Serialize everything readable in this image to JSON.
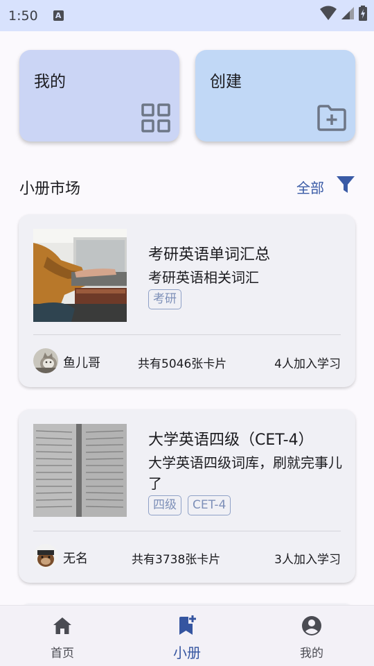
{
  "status_bar": {
    "time": "1:50",
    "notification_letter": "A"
  },
  "quick_actions": [
    {
      "label": "我的",
      "icon": "grid-icon"
    },
    {
      "label": "创建",
      "icon": "folder-plus-icon"
    }
  ],
  "market": {
    "title": "小册市场",
    "filter_label": "全部",
    "filter_icon": "filter-icon"
  },
  "books": [
    {
      "title": "考研英语单词汇总",
      "description": "考研英语相关词汇",
      "tags": [
        "考研"
      ],
      "author": "鱼儿哥",
      "card_count": "共有5046张卡片",
      "learners": "4人加入学习",
      "cover": "person-typing-on-laptop"
    },
    {
      "title": "大学英语四级（CET-4）",
      "description": "大学英语四级词库，刷就完事儿了",
      "tags": [
        "四级",
        "CET-4"
      ],
      "author": "无名",
      "card_count": "共有3738张卡片",
      "learners": "3人加入学习",
      "cover": "open-dictionary-pages"
    }
  ],
  "bottom_nav": [
    {
      "label": "首页",
      "icon": "home-icon",
      "active": false
    },
    {
      "label": "小册",
      "icon": "bookmark-add-icon",
      "active": true
    },
    {
      "label": "我的",
      "icon": "account-circle-icon",
      "active": false
    }
  ],
  "colors": {
    "accent": "#3555a0",
    "status_bar": "#d8e2fd",
    "card_mine": "#cbd5f5",
    "card_create": "#c1d8f6",
    "tag": "#7d8fb8"
  }
}
